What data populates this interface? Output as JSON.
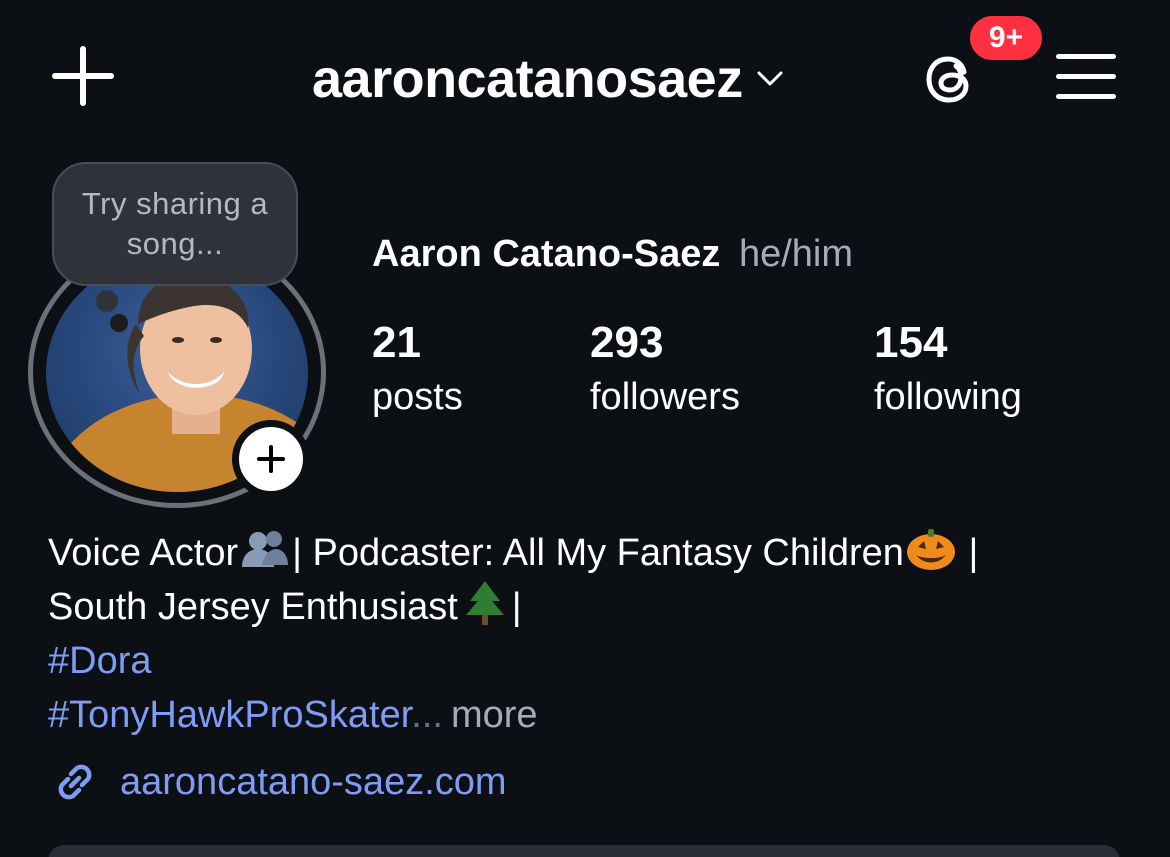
{
  "header": {
    "username": "aaroncatanosaez",
    "notifications_badge": "9+"
  },
  "note": {
    "placeholder": "Try sharing a song..."
  },
  "profile": {
    "full_name": "Aaron Catano-Saez",
    "pronouns": "he/him",
    "stats": {
      "posts": {
        "count": "21",
        "label": "posts"
      },
      "followers": {
        "count": "293",
        "label": "followers"
      },
      "following": {
        "count": "154",
        "label": "following"
      }
    }
  },
  "bio": {
    "line1_a": "Voice Actor",
    "line1_b": "| Podcaster: All My Fantasy Children",
    "line1_c": " |",
    "line2_a": "South Jersey Enthusiast",
    "line2_b": "|",
    "hashtag1": "#Dora",
    "hashtag2": "#TonyHawkProSkater",
    "ellipsis": "...",
    "more": "more"
  },
  "link": {
    "url_text": "aaroncatano-saez.com"
  },
  "colors": {
    "background": "#0c0f14",
    "badge": "#ff3040",
    "link": "#7f9cf5"
  },
  "icons": [
    "plus-icon",
    "chevron-down-icon",
    "threads-icon",
    "menu-icon",
    "add-story-icon",
    "link-icon"
  ]
}
